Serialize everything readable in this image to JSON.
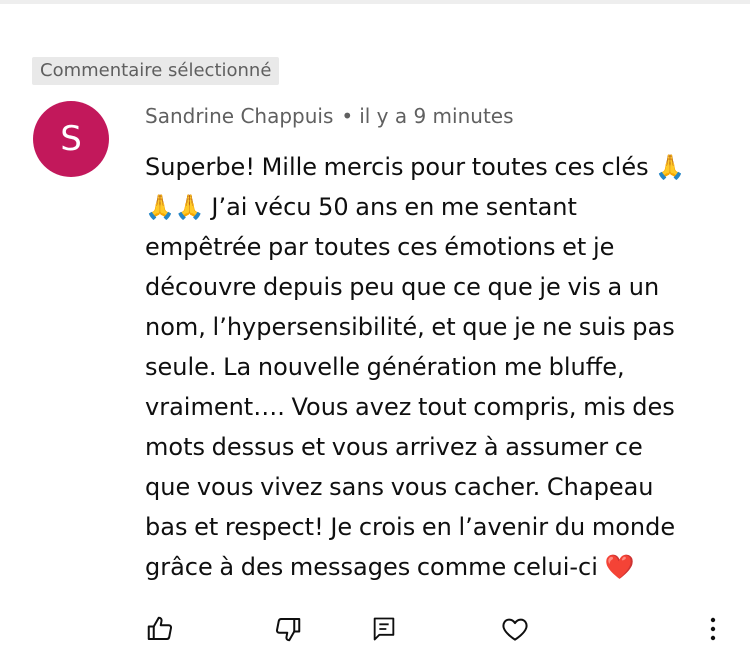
{
  "badge": {
    "label": "Commentaire sélectionné"
  },
  "comment": {
    "avatar_letter": "S",
    "avatar_color": "#c2185b",
    "author": "Sandrine Chappuis",
    "separator": "•",
    "time": "il y a 9 minutes",
    "text": "Superbe! Mille mercis pour toutes ces clés 🙏\n🙏🙏 J’ai vécu 50 ans en me sentant\nempêtrée par toutes ces émotions et je\ndécouvre depuis peu que ce que je vis a un\nnom, l’hypersensibilité, et que je ne suis pas\nseule. La nouvelle génération me bluffe,\nvraiment…. Vous avez tout compris, mis des\nmots dessus et vous arrivez à assumer ce\nque vous vivez sans vous cacher. Chapeau\nbas et respect! Je crois en l’avenir du monde\ngrâce à des messages comme celui-ci ❤️"
  },
  "actions": {
    "like_icon": "thumbs-up-icon",
    "dislike_icon": "thumbs-down-icon",
    "reply_icon": "comment-reply-icon",
    "heart_icon": "heart-icon",
    "more_icon": "more-vertical-icon"
  }
}
